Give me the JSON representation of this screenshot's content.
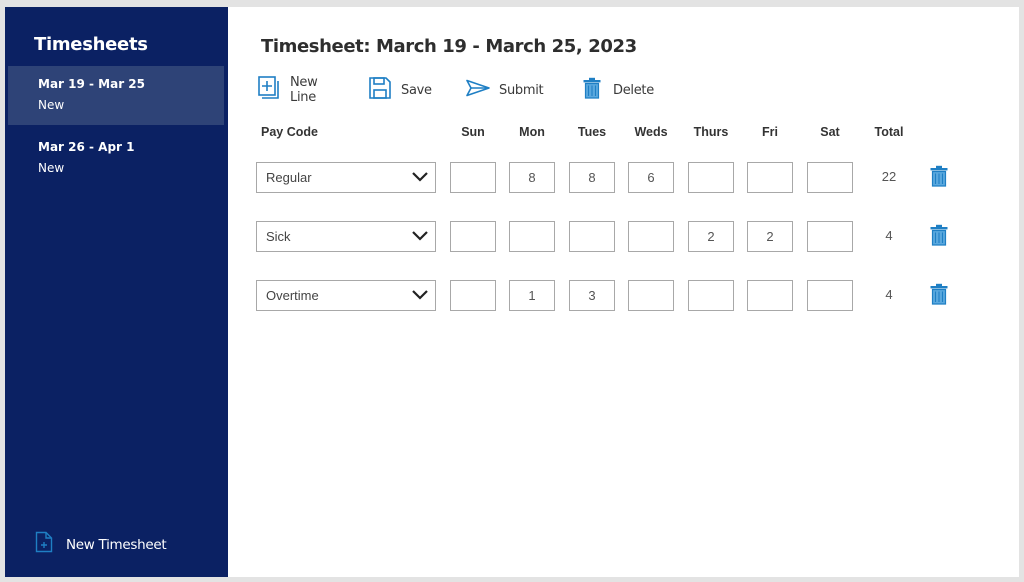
{
  "sidebar": {
    "title": "Timesheets",
    "items": [
      {
        "range": "Mar 19 - Mar 25",
        "status": "New",
        "active": true
      },
      {
        "range": "Mar 26 - Apr 1",
        "status": "New",
        "active": false
      }
    ],
    "new_timesheet_label": "New Timesheet",
    "new_timesheet_icon": "new-document-icon"
  },
  "main": {
    "title": "Timesheet: March 19 - March 25, 2023",
    "toolbar": {
      "new_line": {
        "label": "New Line",
        "icon": "add-line-icon"
      },
      "save": {
        "label": "Save",
        "icon": "floppy-disk-icon"
      },
      "submit": {
        "label": "Submit",
        "icon": "send-icon"
      },
      "delete": {
        "label": "Delete",
        "icon": "trash-icon"
      }
    },
    "columns": {
      "pay_code": "Pay Code",
      "days": [
        "Sun",
        "Mon",
        "Tues",
        "Weds",
        "Thurs",
        "Fri",
        "Sat"
      ],
      "total": "Total"
    },
    "rows": [
      {
        "pay_code": "Regular",
        "hours": [
          "",
          "8",
          "8",
          "6",
          "",
          "",
          ""
        ],
        "total": "22"
      },
      {
        "pay_code": "Sick",
        "hours": [
          "",
          "",
          "",
          "",
          "2",
          "2",
          ""
        ],
        "total": "4"
      },
      {
        "pay_code": "Overtime",
        "hours": [
          "",
          "1",
          "3",
          "",
          "",
          "",
          ""
        ],
        "total": "4"
      }
    ]
  },
  "colors": {
    "sidebar_bg": "#0b2163",
    "sidebar_active": "#2e4377",
    "accent_icon": "#1f7fc4"
  }
}
